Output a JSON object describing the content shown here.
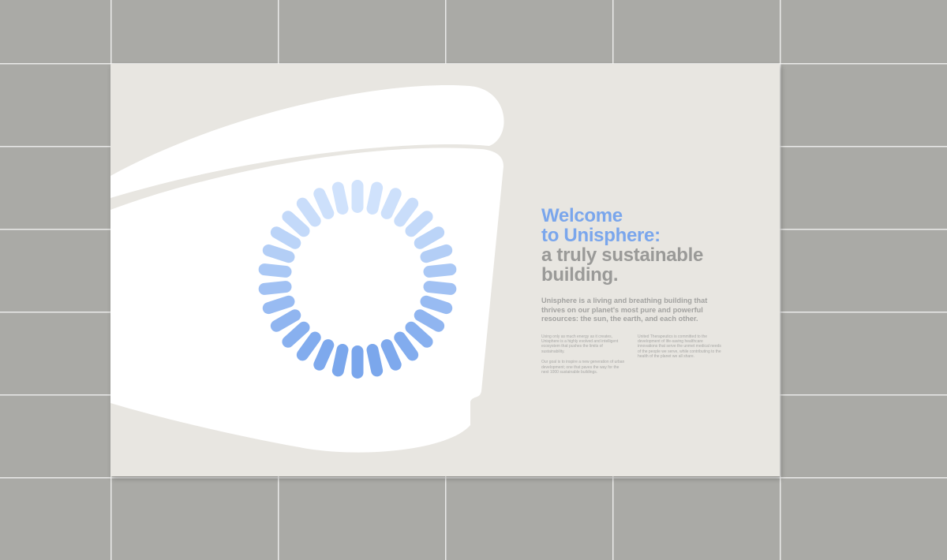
{
  "headline": {
    "line1": "Welcome",
    "line2": "to Unisphere:",
    "line3": "a truly sustainable",
    "line4": "building."
  },
  "lead": "Unisphere is a living and breathing building that thrives on our planet's most pure and powerful resources: the sun, the earth, and each other.",
  "columns": {
    "left_p1": "Using only as much energy as it creates, Unisphere is a highly evolved and intelligent ecosystem that pushes the limits of sustainability.",
    "left_p2": "Our goal is to inspire a new generation of urban development; one that paves the way for the next 1000 sustainable buildings.",
    "right_p1": "United Therapeutics is committed to the development of life-saving healthcare innovations that serve the unmet medical needs of the people we serve, while contributing to the health of the planet we all share."
  },
  "colors": {
    "wall": "#aaaaa6",
    "panel": "#e8e6e1",
    "accent_blue": "#7aa6ec",
    "text_grey": "#9a9a98"
  },
  "sunburst": {
    "segments": 30
  }
}
